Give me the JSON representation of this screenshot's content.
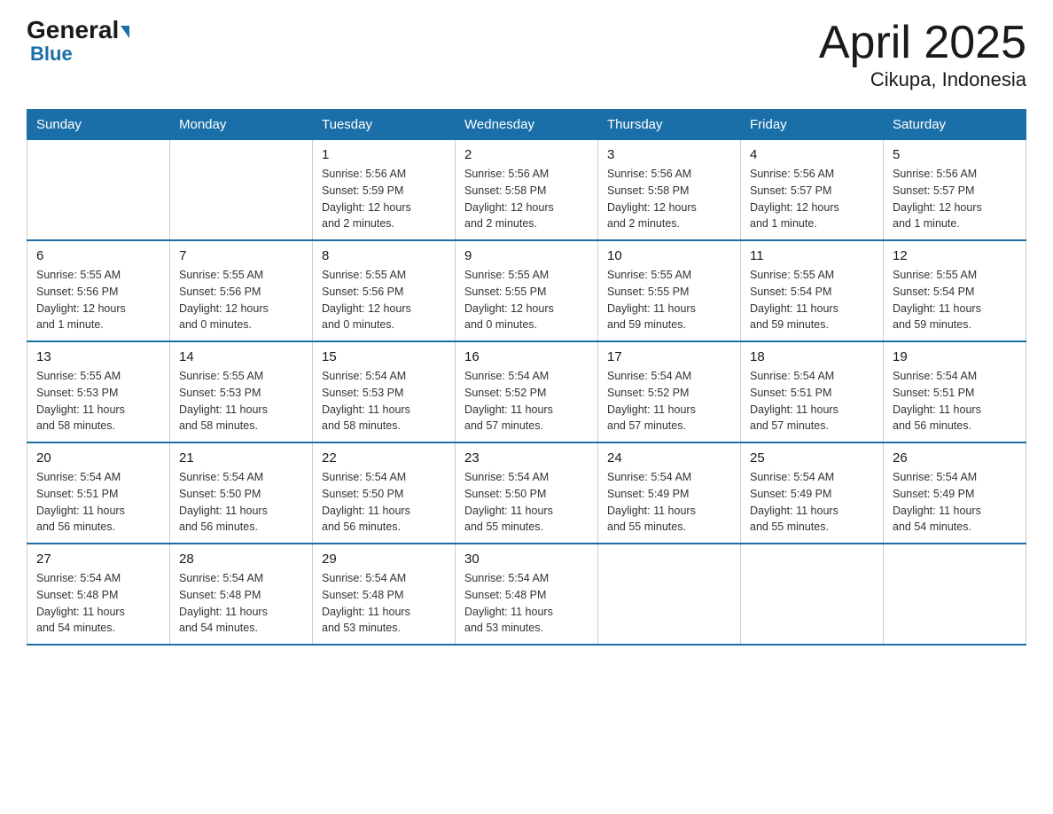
{
  "header": {
    "logo_general": "General",
    "logo_blue": "Blue",
    "title": "April 2025",
    "subtitle": "Cikupa, Indonesia"
  },
  "days_of_week": [
    "Sunday",
    "Monday",
    "Tuesday",
    "Wednesday",
    "Thursday",
    "Friday",
    "Saturday"
  ],
  "weeks": [
    [
      {
        "day": "",
        "info": ""
      },
      {
        "day": "",
        "info": ""
      },
      {
        "day": "1",
        "info": "Sunrise: 5:56 AM\nSunset: 5:59 PM\nDaylight: 12 hours\nand 2 minutes."
      },
      {
        "day": "2",
        "info": "Sunrise: 5:56 AM\nSunset: 5:58 PM\nDaylight: 12 hours\nand 2 minutes."
      },
      {
        "day": "3",
        "info": "Sunrise: 5:56 AM\nSunset: 5:58 PM\nDaylight: 12 hours\nand 2 minutes."
      },
      {
        "day": "4",
        "info": "Sunrise: 5:56 AM\nSunset: 5:57 PM\nDaylight: 12 hours\nand 1 minute."
      },
      {
        "day": "5",
        "info": "Sunrise: 5:56 AM\nSunset: 5:57 PM\nDaylight: 12 hours\nand 1 minute."
      }
    ],
    [
      {
        "day": "6",
        "info": "Sunrise: 5:55 AM\nSunset: 5:56 PM\nDaylight: 12 hours\nand 1 minute."
      },
      {
        "day": "7",
        "info": "Sunrise: 5:55 AM\nSunset: 5:56 PM\nDaylight: 12 hours\nand 0 minutes."
      },
      {
        "day": "8",
        "info": "Sunrise: 5:55 AM\nSunset: 5:56 PM\nDaylight: 12 hours\nand 0 minutes."
      },
      {
        "day": "9",
        "info": "Sunrise: 5:55 AM\nSunset: 5:55 PM\nDaylight: 12 hours\nand 0 minutes."
      },
      {
        "day": "10",
        "info": "Sunrise: 5:55 AM\nSunset: 5:55 PM\nDaylight: 11 hours\nand 59 minutes."
      },
      {
        "day": "11",
        "info": "Sunrise: 5:55 AM\nSunset: 5:54 PM\nDaylight: 11 hours\nand 59 minutes."
      },
      {
        "day": "12",
        "info": "Sunrise: 5:55 AM\nSunset: 5:54 PM\nDaylight: 11 hours\nand 59 minutes."
      }
    ],
    [
      {
        "day": "13",
        "info": "Sunrise: 5:55 AM\nSunset: 5:53 PM\nDaylight: 11 hours\nand 58 minutes."
      },
      {
        "day": "14",
        "info": "Sunrise: 5:55 AM\nSunset: 5:53 PM\nDaylight: 11 hours\nand 58 minutes."
      },
      {
        "day": "15",
        "info": "Sunrise: 5:54 AM\nSunset: 5:53 PM\nDaylight: 11 hours\nand 58 minutes."
      },
      {
        "day": "16",
        "info": "Sunrise: 5:54 AM\nSunset: 5:52 PM\nDaylight: 11 hours\nand 57 minutes."
      },
      {
        "day": "17",
        "info": "Sunrise: 5:54 AM\nSunset: 5:52 PM\nDaylight: 11 hours\nand 57 minutes."
      },
      {
        "day": "18",
        "info": "Sunrise: 5:54 AM\nSunset: 5:51 PM\nDaylight: 11 hours\nand 57 minutes."
      },
      {
        "day": "19",
        "info": "Sunrise: 5:54 AM\nSunset: 5:51 PM\nDaylight: 11 hours\nand 56 minutes."
      }
    ],
    [
      {
        "day": "20",
        "info": "Sunrise: 5:54 AM\nSunset: 5:51 PM\nDaylight: 11 hours\nand 56 minutes."
      },
      {
        "day": "21",
        "info": "Sunrise: 5:54 AM\nSunset: 5:50 PM\nDaylight: 11 hours\nand 56 minutes."
      },
      {
        "day": "22",
        "info": "Sunrise: 5:54 AM\nSunset: 5:50 PM\nDaylight: 11 hours\nand 56 minutes."
      },
      {
        "day": "23",
        "info": "Sunrise: 5:54 AM\nSunset: 5:50 PM\nDaylight: 11 hours\nand 55 minutes."
      },
      {
        "day": "24",
        "info": "Sunrise: 5:54 AM\nSunset: 5:49 PM\nDaylight: 11 hours\nand 55 minutes."
      },
      {
        "day": "25",
        "info": "Sunrise: 5:54 AM\nSunset: 5:49 PM\nDaylight: 11 hours\nand 55 minutes."
      },
      {
        "day": "26",
        "info": "Sunrise: 5:54 AM\nSunset: 5:49 PM\nDaylight: 11 hours\nand 54 minutes."
      }
    ],
    [
      {
        "day": "27",
        "info": "Sunrise: 5:54 AM\nSunset: 5:48 PM\nDaylight: 11 hours\nand 54 minutes."
      },
      {
        "day": "28",
        "info": "Sunrise: 5:54 AM\nSunset: 5:48 PM\nDaylight: 11 hours\nand 54 minutes."
      },
      {
        "day": "29",
        "info": "Sunrise: 5:54 AM\nSunset: 5:48 PM\nDaylight: 11 hours\nand 53 minutes."
      },
      {
        "day": "30",
        "info": "Sunrise: 5:54 AM\nSunset: 5:48 PM\nDaylight: 11 hours\nand 53 minutes."
      },
      {
        "day": "",
        "info": ""
      },
      {
        "day": "",
        "info": ""
      },
      {
        "day": "",
        "info": ""
      }
    ]
  ]
}
